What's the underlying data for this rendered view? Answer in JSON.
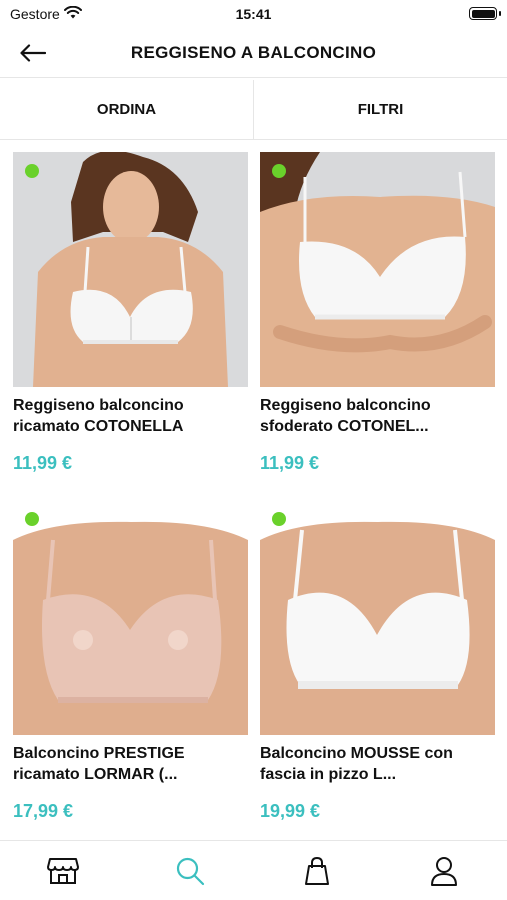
{
  "status": {
    "carrier": "Gestore",
    "time": "15:41"
  },
  "nav": {
    "title": "REGGISENO A BALCONCINO",
    "back_icon": "arrow-left-icon"
  },
  "actions": {
    "sort_label": "ORDINA",
    "filter_label": "FILTRI"
  },
  "products": [
    {
      "title": "Reggiseno balconcino ricamato COTONELLA",
      "price": "11,99 €",
      "available": true,
      "image": "white-lace-bra"
    },
    {
      "title": "Reggiseno balconcino sfoderato COTONEL...",
      "price": "11,99 €",
      "available": true,
      "image": "white-lace-bra-unlined"
    },
    {
      "title": "Balconcino PRESTIGE ricamato LORMAR (...",
      "price": "17,99 €",
      "available": true,
      "image": "nude-lace-bra"
    },
    {
      "title": "Balconcino MOUSSE con fascia in pizzo L...",
      "price": "19,99 €",
      "available": true,
      "image": "white-mousse-bra"
    }
  ],
  "tabs": [
    {
      "icon": "store-icon",
      "active": false
    },
    {
      "icon": "search-icon",
      "active": true
    },
    {
      "icon": "shopping-bag-icon",
      "active": false
    },
    {
      "icon": "user-icon",
      "active": false
    }
  ],
  "colors": {
    "accent": "#3bbfbf",
    "available_dot": "#6ad12b",
    "divider": "#e6e6e6"
  }
}
